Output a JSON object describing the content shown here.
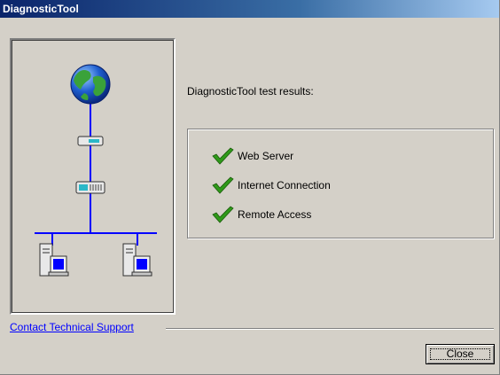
{
  "window": {
    "title": "DiagnosticTool"
  },
  "illustration": {
    "icons": [
      "globe-icon",
      "modem-icon",
      "router-icon",
      "workstation-icon",
      "workstation-icon"
    ]
  },
  "results": {
    "heading": "DiagnosticTool test results:",
    "items": [
      {
        "label": "Web Server",
        "status_icon": "green-checkmark-icon"
      },
      {
        "label": "Internet Connection",
        "status_icon": "green-checkmark-icon"
      },
      {
        "label": "Remote Access",
        "status_icon": "green-checkmark-icon"
      }
    ]
  },
  "support": {
    "link_label": "Contact Technical Support"
  },
  "buttons": {
    "close_label": "Close"
  },
  "colors": {
    "titlebar_start": "#0a246a",
    "titlebar_end": "#a6caf0",
    "face": "#d4d0c8",
    "link": "#0000ff",
    "network_line": "#0000ff",
    "check": "#2f9a1a"
  }
}
